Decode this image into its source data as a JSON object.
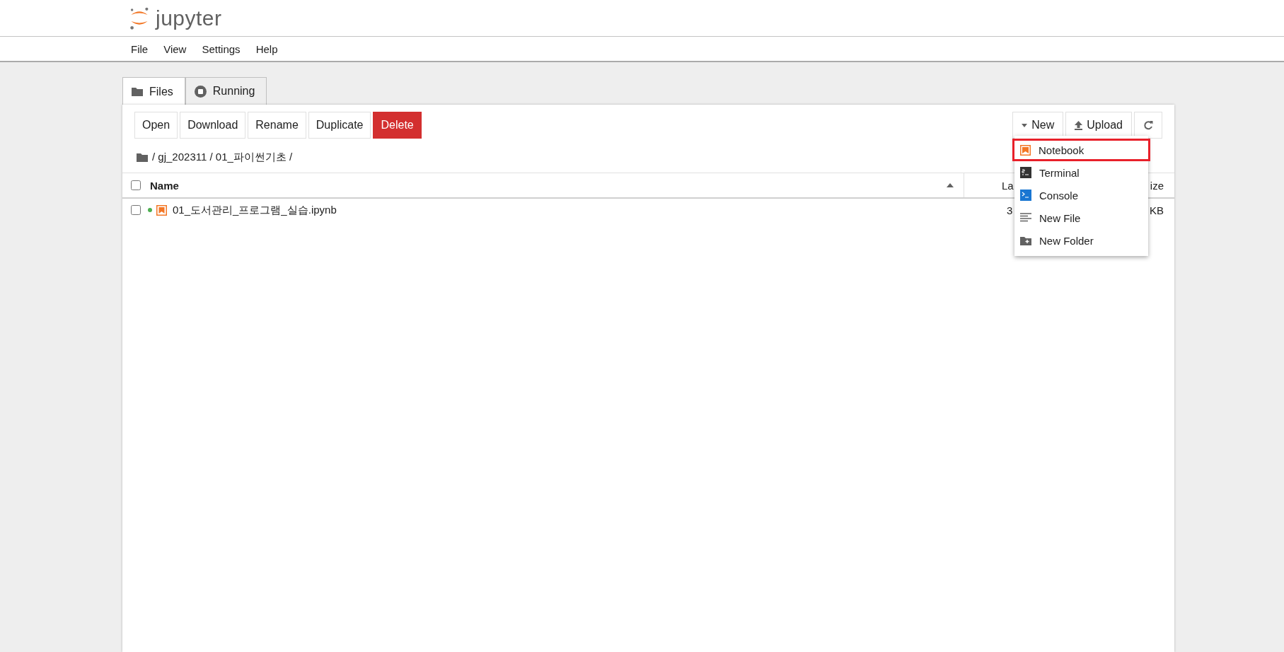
{
  "header": {
    "logo_text": "jupyter"
  },
  "menu": [
    "File",
    "View",
    "Settings",
    "Help"
  ],
  "tabs": [
    {
      "label": "Files",
      "kind": "files",
      "selected": true
    },
    {
      "label": "Running",
      "kind": "running",
      "selected": false
    }
  ],
  "toolbar": {
    "left_buttons": [
      {
        "label": "Open",
        "kind": "plain"
      },
      {
        "label": "Download",
        "kind": "plain"
      },
      {
        "label": "Rename",
        "kind": "plain"
      },
      {
        "label": "Duplicate",
        "kind": "plain"
      },
      {
        "label": "Delete",
        "kind": "danger"
      }
    ],
    "new_button": "New",
    "upload_button": "Upload"
  },
  "breadcrumb": "/ gj_202311 / 01_파이썬기초 /",
  "table": {
    "select_all_checked": false,
    "columns": [
      {
        "label": "Name",
        "sorted": true
      },
      {
        "label": "La"
      },
      {
        "label": "ize"
      }
    ],
    "rows": [
      {
        "name": "01_도서관리_프로그램_실습.ipynb",
        "checked": false,
        "running": true,
        "column_2": "3",
        "column_3": "KB"
      }
    ]
  },
  "new_menu": [
    {
      "label": "Notebook",
      "kind": "notebook",
      "selected": true
    },
    {
      "label": "Terminal",
      "kind": "terminal",
      "selected": false
    },
    {
      "label": "Console",
      "kind": "console",
      "selected": false
    },
    {
      "label": "New File",
      "kind": "file",
      "selected": false
    },
    {
      "label": "New Folder",
      "kind": "folder",
      "selected": false
    }
  ]
}
